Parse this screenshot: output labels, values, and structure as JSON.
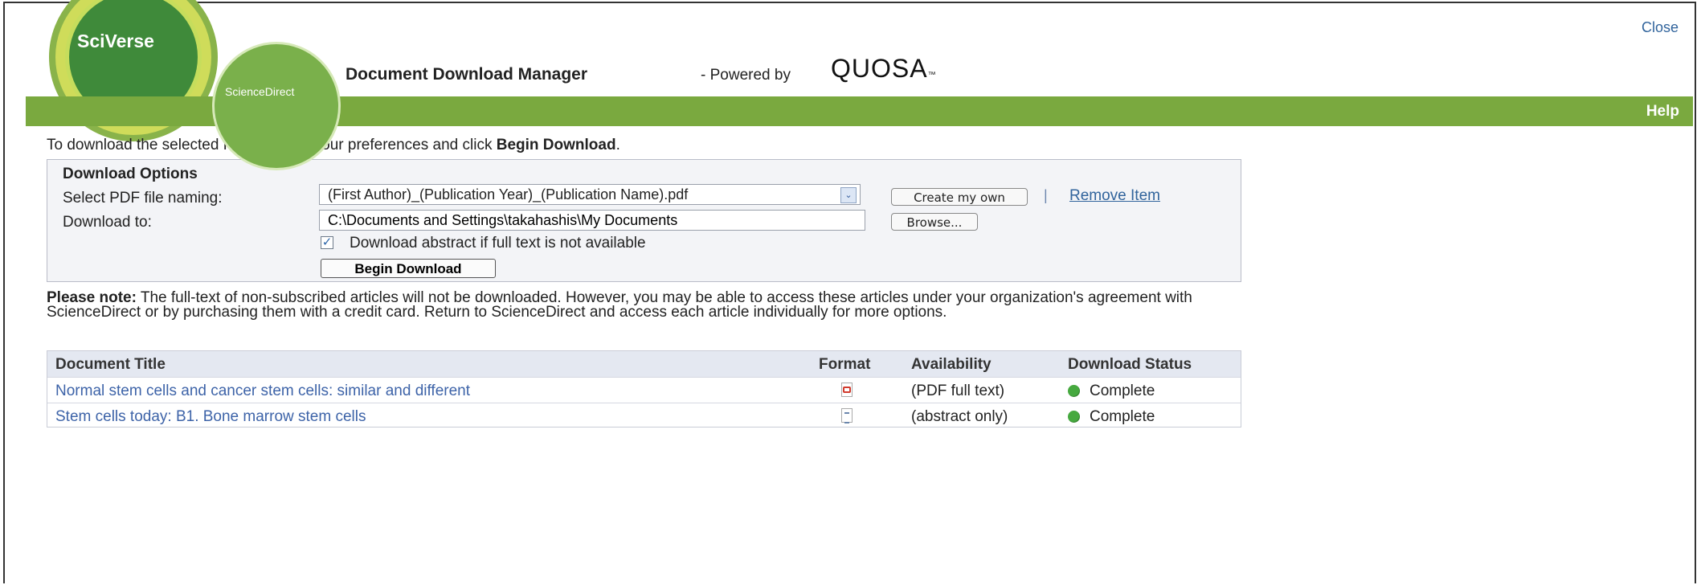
{
  "branding": {
    "main_logo": "SciVerse",
    "sub_logo": "ScienceDirect",
    "title": "Document Download Manager",
    "powered_by": "- Powered by",
    "partner": "QUOSA",
    "trademark": "™"
  },
  "links": {
    "close": "Close",
    "help": "Help",
    "remove_item": "Remove Item"
  },
  "intro": {
    "text": "To download the selected PDFs, select your preferences and click ",
    "highlight": "Begin Download",
    "suffix": "."
  },
  "download_options": {
    "title": "Download Options",
    "naming_label": "Select PDF file naming:",
    "naming_value": "(First Author)_(Publication Year)_(Publication Name).pdf",
    "download_to_label": "Download to:",
    "download_to_value": "C:\\Documents and Settings\\takahashis\\My Documents",
    "create_button": "Create my own",
    "browse_button": "Browse...",
    "separator": "|",
    "abstract_option": "Download abstract if full text is not available",
    "abstract_checked": true,
    "begin_button": "Begin Download"
  },
  "notice": {
    "label": "Please note:",
    "text": " The full-text of non-subscribed articles will not be downloaded. However, you may be able to access these articles under your organization's agreement with ScienceDirect or by purchasing them with a credit card. Return to ScienceDirect and access each article individually for more options."
  },
  "table": {
    "headers": [
      "Document Title",
      "Format",
      "Availability",
      "Download Status"
    ],
    "rows": [
      {
        "title": "Normal stem cells and cancer stem cells: similar and different",
        "format": "pdf-icon",
        "availability": "(PDF full text)",
        "status": "Complete"
      },
      {
        "title": "Stem cells today: B1. Bone marrow stem cells",
        "format": "abstract-icon",
        "availability": "(abstract only)",
        "status": "Complete"
      }
    ]
  },
  "colors": {
    "green_bar": "#7aa93f",
    "link_blue": "#3d63a8",
    "complete_green": "#46a93f"
  }
}
